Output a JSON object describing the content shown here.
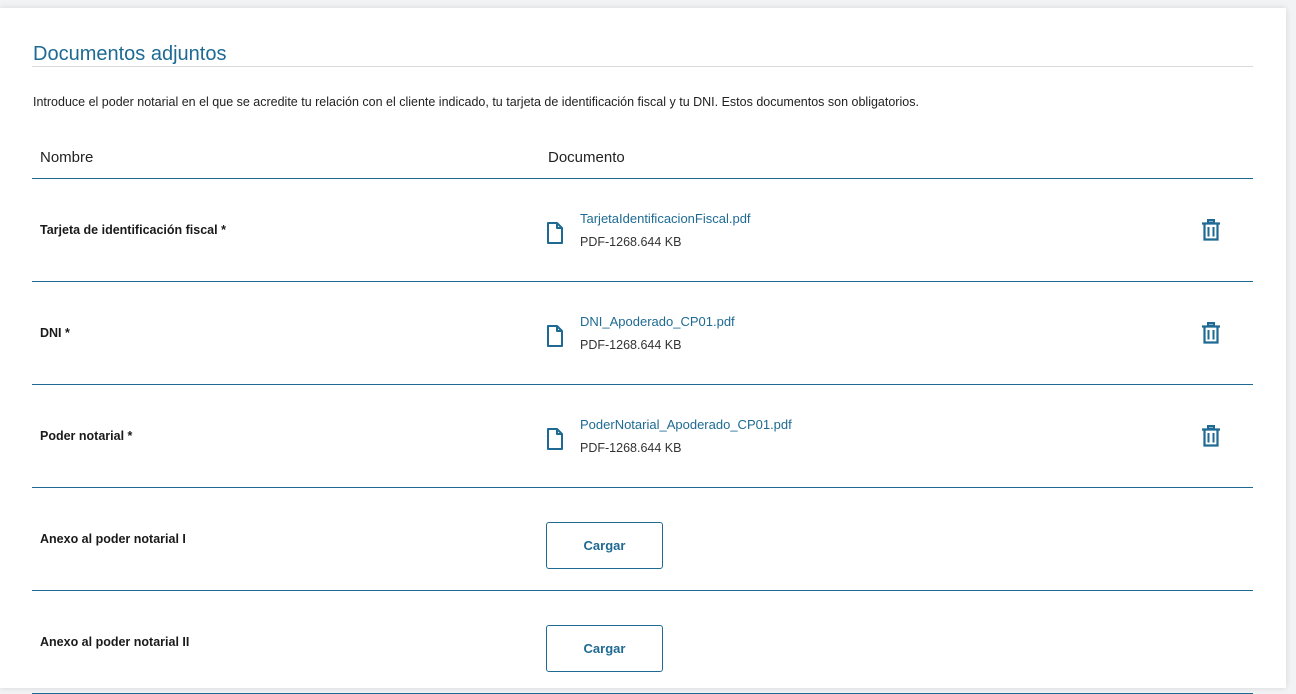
{
  "section": {
    "title": "Documentos adjuntos",
    "intro": "Introduce el poder notarial en el que se acredite tu relación con el cliente indicado, tu tarjeta de identificación fiscal y tu DNI. Estos documentos son obligatorios."
  },
  "table": {
    "col_name": "Nombre",
    "col_document": "Documento",
    "rows": [
      {
        "name": "Tarjeta de identificación fiscal *",
        "file_name": "TarjetaIdentificacionFiscal.pdf",
        "file_meta": "PDF-1268.644 KB",
        "file_icon": "document-icon",
        "action_icon": "trash-icon"
      },
      {
        "name": "DNI *",
        "file_name": "DNI_Apoderado_CP01.pdf",
        "file_meta": "PDF-1268.644 KB",
        "file_icon": "document-icon",
        "action_icon": "trash-icon"
      },
      {
        "name": "Poder notarial *",
        "file_name": "PoderNotarial_Apoderado_CP01.pdf",
        "file_meta": "PDF-1268.644 KB",
        "file_icon": "document-icon",
        "action_icon": "trash-icon"
      },
      {
        "name": "Anexo al poder notarial I",
        "upload_label": "Cargar"
      },
      {
        "name": "Anexo al poder notarial II",
        "upload_label": "Cargar"
      }
    ]
  },
  "colors": {
    "accent": "#1e6a93",
    "text": "#222222",
    "divider": "#d7dadd"
  }
}
